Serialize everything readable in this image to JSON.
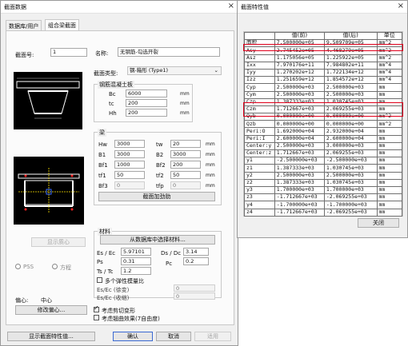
{
  "left_window": {
    "title": "截面数据",
    "close": "×",
    "tabs": [
      "数据库/用户",
      "组合梁截面"
    ],
    "section_no_label": "截面号:",
    "section_no": "1",
    "name_label": "名称:",
    "name_value": "无钢筋-勾选开裂",
    "section_type_label": "截面类型:",
    "section_type_value": "钢-箱形 (Type1)",
    "slab_group": "钢筋混凝土板",
    "slab_rows": [
      {
        "label": "Bc",
        "value": "6000",
        "unit": "mm"
      },
      {
        "label": "tc",
        "value": "200",
        "unit": "mm"
      },
      {
        "label": "Hh",
        "value": "200",
        "unit": "mm"
      }
    ],
    "beam_group": "梁",
    "beam_rows": [
      {
        "l1": "Hw",
        "v1": "3000",
        "l2": "tw",
        "v2": "20",
        "u": "mm"
      },
      {
        "l1": "B1",
        "v1": "3000",
        "l2": "B2",
        "v2": "3000",
        "u": "mm"
      },
      {
        "l1": "Bf1",
        "v1": "1000",
        "l2": "Bf2",
        "v2": "200",
        "u": "mm"
      },
      {
        "l1": "tf1",
        "v1": "50",
        "l2": "tf2",
        "v2": "50",
        "u": "mm"
      },
      {
        "l1": "Bf3",
        "v1": "0",
        "l2": "tfp",
        "v2": "0",
        "u": "mm"
      }
    ],
    "add_stiffener_button": "截面加劲肋",
    "material_group": "材料",
    "select_material_button": "从数据库中选择材料...",
    "es_ec_label": "Es / Ec",
    "es_ec_value": "5.97101",
    "ds_dc_label": "Ds / Dc",
    "ds_dc_value": "3.14",
    "ps_label": "Ps",
    "ps_value": "0.31",
    "pc_label": "Pc",
    "pc_value": "0.2",
    "ts_tc_label": "Ts / Tc",
    "ts_tc_value": "1.2",
    "multi_modulus_label": "多个弹性模量比",
    "es_ec_creep_label": "Es/Ec (徐变)",
    "es_ec_creep_value": "0",
    "es_ec_shrink_label": "Es/Ec (收缩)",
    "es_ec_shrink_value": "0",
    "show_centroid_button": "显示质心",
    "radio_pss": "PSS",
    "radio_square": "方程",
    "offset_label": "偏心:",
    "offset_value": "中心",
    "modify_offset_button": "修改偏心...",
    "shear_deform_label": "考虑剪切变形",
    "warp_label": "考虑翘曲效果(7自由度)",
    "show_props_button": "显示截面特性值...",
    "ok_button": "确认",
    "cancel_button": "取消",
    "apply_button": "适用"
  },
  "right_window": {
    "title": "截面特性值",
    "close": "×",
    "headers": [
      "",
      "值(前)",
      "值(后)",
      "单位"
    ],
    "rows": [
      [
        "面积",
        "7.500000e+05",
        "9.509709e+05",
        "mm^2"
      ],
      [
        "Asy",
        "2.745452e+05",
        "4.468279e+05",
        "mm^2"
      ],
      [
        "Asz",
        "1.175056e+05",
        "1.225922e+05",
        "mm^2"
      ],
      [
        "Ixx",
        "7.970176e+11",
        "7.984802e+11",
        "mm^4"
      ],
      [
        "Iyy",
        "1.270202e+12",
        "1.722134e+12",
        "mm^4"
      ],
      [
        "Izz",
        "1.251659e+12",
        "1.854572e+12",
        "mm^4"
      ],
      [
        "Cyp",
        "2.500000e+03",
        "2.500000e+03",
        "mm"
      ],
      [
        "Cym",
        "2.500000e+03",
        "2.500000e+03",
        "mm"
      ],
      [
        "Czp",
        "1.387333e+03",
        "1.030745e+03",
        "mm"
      ],
      [
        "Czm",
        "1.712667e+03",
        "2.069255e+03",
        "mm"
      ],
      [
        "Qyb",
        "0.000000e+00",
        "0.000000e+00",
        "mm^2"
      ],
      [
        "Qzb",
        "0.000000e+00",
        "0.000000e+00",
        "mm^2"
      ],
      [
        "Peri:O",
        "1.692000e+04",
        "2.932000e+04",
        "mm"
      ],
      [
        "Peri:I",
        "2.600000e+04",
        "2.600000e+04",
        "mm"
      ],
      [
        "Center:y",
        "2.500000e+03",
        "3.000000e+03",
        "mm"
      ],
      [
        "Center:z",
        "1.712667e+03",
        "2.069255e+03",
        "mm"
      ],
      [
        "y1",
        "-2.500000e+03",
        "-2.500000e+03",
        "mm"
      ],
      [
        "z1",
        "1.387333e+03",
        "1.030745e+03",
        "mm"
      ],
      [
        "y2",
        "2.500000e+03",
        "2.500000e+03",
        "mm"
      ],
      [
        "z2",
        "1.387333e+03",
        "1.030745e+03",
        "mm"
      ],
      [
        "y3",
        "1.700000e+03",
        "1.700000e+03",
        "mm"
      ],
      [
        "z3",
        "-1.712667e+03",
        "-2.069255e+03",
        "mm"
      ],
      [
        "y4",
        "-1.700000e+03",
        "-1.700000e+03",
        "mm"
      ],
      [
        "z4",
        "-1.712667e+03",
        "-2.069255e+03",
        "mm"
      ]
    ],
    "close_button": "关闭"
  },
  "colors": {
    "highlight_red": "#e0001b",
    "window_bg": "#f0f0f0"
  }
}
